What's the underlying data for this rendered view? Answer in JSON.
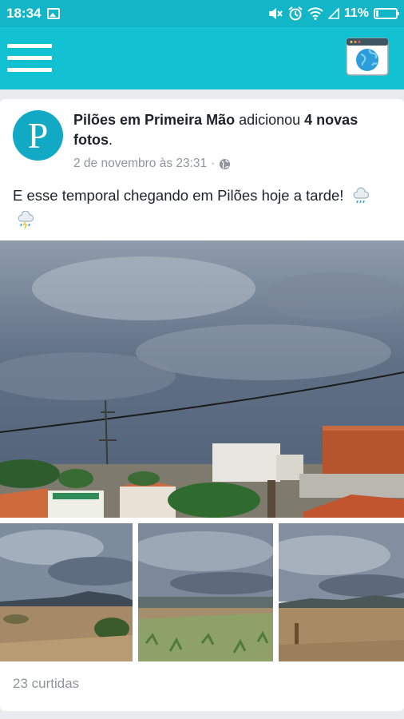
{
  "status_bar": {
    "time": "18:34",
    "battery": "11%",
    "battery_level": 0.11
  },
  "app_bar": {
    "menu_icon": "hamburger-menu-icon",
    "browser_icon": "web-browser-icon"
  },
  "post": {
    "avatar_letter": "P",
    "page_name": "Pilões em Primeira Mão",
    "action_text": " adicionou ",
    "photo_count_text": "4 novas fotos",
    "period": ".",
    "date": "2 de novembro às 23:31",
    "separator": "·",
    "privacy_icon": "globe-icon",
    "text": "E esse temporal chegando em Pilões hoje a tarde!",
    "emojis": [
      "rain-cloud-icon",
      "storm-cloud-icon"
    ],
    "likes": "23 curtidas"
  },
  "colors": {
    "brand": "#12c2d2",
    "status_bar": "#12b6c6",
    "avatar": "#12a9c4"
  }
}
